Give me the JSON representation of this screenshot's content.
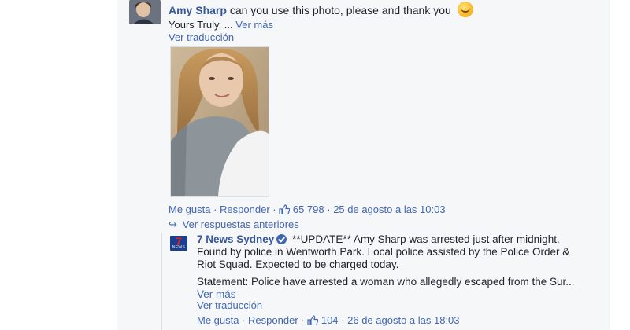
{
  "comment1": {
    "author": "Amy Sharp",
    "text": "can you use this photo, please and thank you",
    "emoji": "smiling-face-emoji",
    "text2": "Yours Truly, ...",
    "see_more": "Ver más",
    "translate": "Ver traducción",
    "photo": "portrait-photo",
    "like": "Me gusta",
    "reply": "Responder",
    "likes_count": "65 798",
    "timestamp": "25 de agosto a las 10:03",
    "sep": " · "
  },
  "previous_replies": "Ver respuestas anteriores",
  "comment2": {
    "author": "7 News Sydney",
    "logo_number": "7",
    "logo_text": "NEWS",
    "text": "**UPDATE** Amy Sharp was arrested just after midnight. Found by police in Wentworth Park. Local police assisted by the Police Order & Riot Squad. Expected to be charged today.",
    "text2": "Statement: Police have arrested a woman who allegedly escaped from the Sur...",
    "see_more": "Ver más",
    "translate": "Ver traducción",
    "like": "Me gusta",
    "reply": "Responder",
    "likes_count": "104",
    "timestamp": "26 de agosto a las 18:03",
    "sep": " · "
  },
  "colors": {
    "link": "#4267b2",
    "author": "#365899",
    "panel": "#f6f7f9",
    "muted": "#90949c"
  }
}
